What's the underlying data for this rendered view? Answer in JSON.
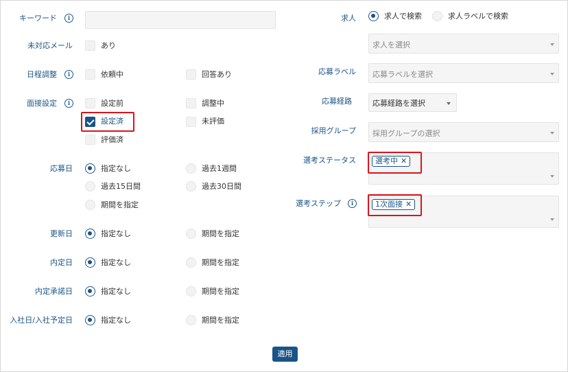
{
  "left": {
    "keyword": {
      "label": "キーワード",
      "value": ""
    },
    "unhandled_mail": {
      "label": "未対応メール",
      "options": [
        "あり"
      ]
    },
    "schedule": {
      "label": "日程調整",
      "options": [
        "依頼中",
        "回答あり"
      ]
    },
    "interview": {
      "label": "面接設定",
      "options": [
        "設定前",
        "調整中",
        "設定済",
        "未評価",
        "評価済"
      ],
      "checked": "設定済"
    },
    "apply_date": {
      "label": "応募日",
      "options": [
        "指定なし",
        "過去1週間",
        "過去15日間",
        "過去30日間",
        "期間を指定"
      ],
      "selected": "指定なし"
    },
    "update_date": {
      "label": "更新日",
      "options": [
        "指定なし",
        "期間を指定"
      ],
      "selected": "指定なし"
    },
    "offer_date": {
      "label": "内定日",
      "options": [
        "指定なし",
        "期間を指定"
      ],
      "selected": "指定なし"
    },
    "offer_accept_date": {
      "label": "内定承諾日",
      "options": [
        "指定なし",
        "期間を指定"
      ],
      "selected": "指定なし"
    },
    "join_date": {
      "label": "入社日/入社予定日",
      "options": [
        "指定なし",
        "期間を指定"
      ],
      "selected": "指定なし"
    }
  },
  "right": {
    "job": {
      "label": "求人",
      "options": [
        "求人で検索",
        "求人ラベルで検索"
      ],
      "selected": "求人で検索",
      "placeholder": "求人を選択"
    },
    "apply_label": {
      "label": "応募ラベル",
      "placeholder": "応募ラベルを選択"
    },
    "apply_route": {
      "label": "応募経路",
      "placeholder": "応募経路を選択"
    },
    "hiring_group": {
      "label": "採用グループ",
      "placeholder": "採用グループの選択"
    },
    "selection_status": {
      "label": "選考ステータス",
      "tags": [
        "選考中"
      ]
    },
    "selection_step": {
      "label": "選考ステップ",
      "tags": [
        "1次面接"
      ]
    }
  },
  "apply_button": "適用",
  "icons": {
    "info": "info-icon",
    "tag_remove": "close-icon",
    "select": "chevron-down-icon"
  },
  "colors": {
    "accent": "#1a5486",
    "highlight": "#d9141a"
  }
}
